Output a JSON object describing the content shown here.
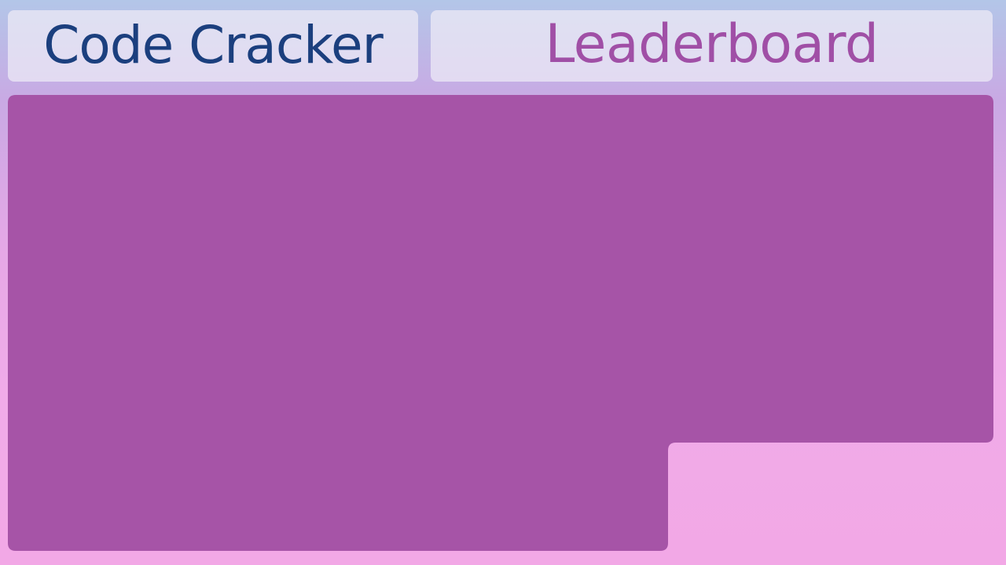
{
  "header": {
    "title": "Code Cracker",
    "leaderboard_label": "Leaderboard"
  },
  "colors": {
    "title_text": "#1b3f7e",
    "leaderboard_text": "#a04fa6",
    "board_fill": "#a654a7",
    "header_panel": "#ecebf6"
  }
}
